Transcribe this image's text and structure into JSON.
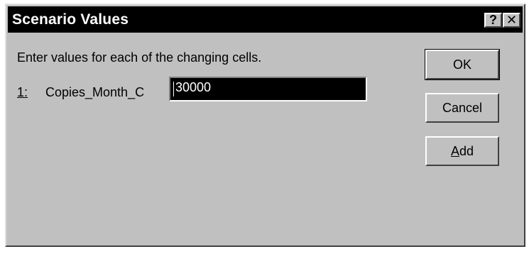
{
  "window": {
    "title": "Scenario Values",
    "help_glyph": "?",
    "close_glyph": "✕"
  },
  "main": {
    "instruction": "Enter values for each of the changing cells.",
    "rows": [
      {
        "number": "1:",
        "label": "Copies_Month_C",
        "value": "30000"
      }
    ]
  },
  "buttons": {
    "ok": "OK",
    "cancel": "Cancel",
    "add_mnemonic": "A",
    "add_rest": "dd"
  },
  "colors": {
    "dialog_face": "#c0c0c0",
    "title_bar": "#000000",
    "field_selected_bg": "#000000",
    "field_selected_text": "#ffffff"
  }
}
